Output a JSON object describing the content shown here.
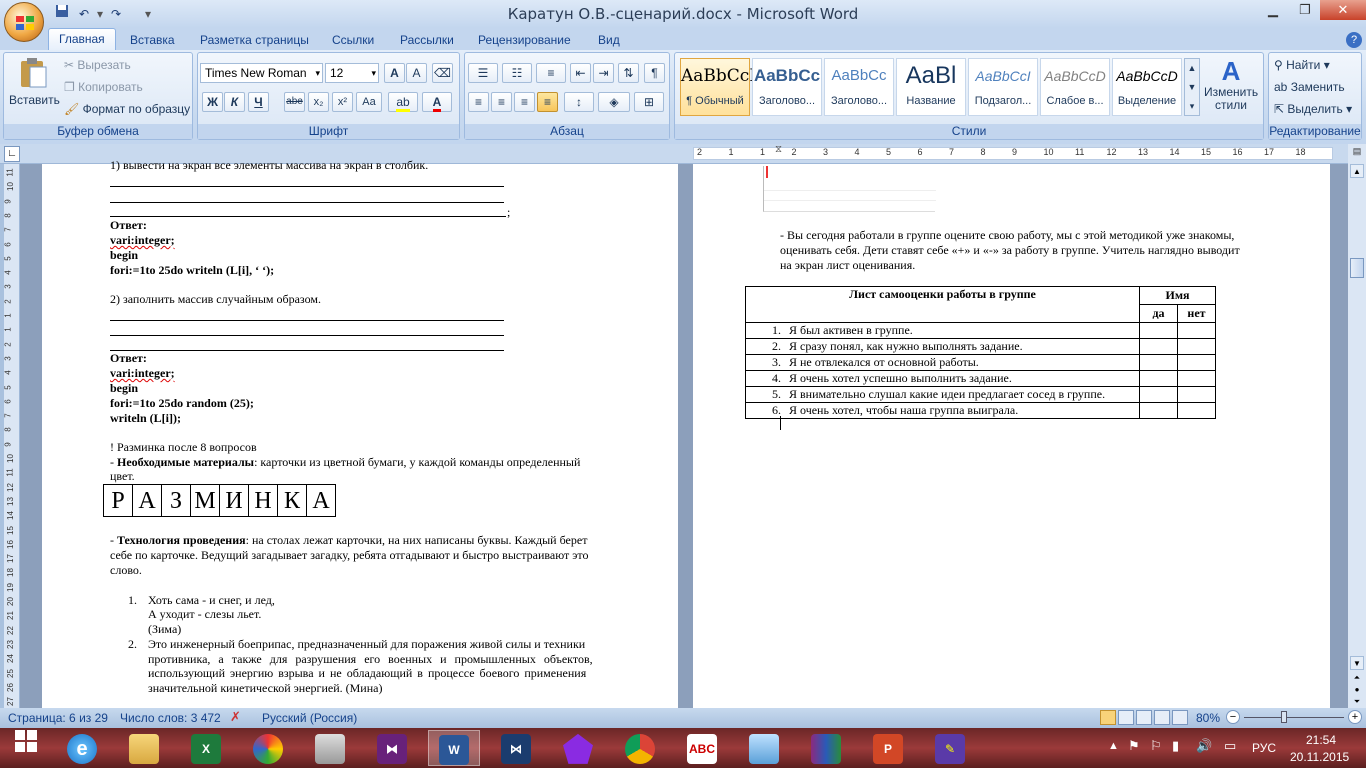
{
  "window": {
    "title": "Каратун О.В.-сценарий.docx - Microsoft Word"
  },
  "tabs": [
    "Главная",
    "Вставка",
    "Разметка страницы",
    "Ссылки",
    "Рассылки",
    "Рецензирование",
    "Вид"
  ],
  "clipboard": {
    "paste": "Вставить",
    "cut": "Вырезать",
    "copy": "Копировать",
    "format": "Формат по образцу",
    "label": "Буфер обмена"
  },
  "font": {
    "name": "Times New Roman",
    "size": "12",
    "label": "Шрифт",
    "bold": "Ж",
    "italic": "К",
    "underline": "Ч",
    "strike": "abe",
    "sub": "x₂",
    "sup": "x²",
    "case": "Aa"
  },
  "paragraph": {
    "label": "Абзац"
  },
  "styles": {
    "label": "Стили",
    "change": "Изменить стили",
    "items": [
      {
        "preview": "AaBbCcI",
        "name": "¶ Обычный"
      },
      {
        "preview": "AaBbCc",
        "name": "Заголово..."
      },
      {
        "preview": "AaBbCc",
        "name": "Заголово..."
      },
      {
        "preview": "AaBl",
        "name": "Название"
      },
      {
        "preview": "AaBbCcI",
        "name": "Подзагол..."
      },
      {
        "preview": "AaBbCcD",
        "name": "Слабое в..."
      },
      {
        "preview": "AaBbCcD",
        "name": "Выделение"
      }
    ]
  },
  "editing": {
    "label": "Редактирование",
    "find": "Найти",
    "replace": "Заменить",
    "select": "Выделить"
  },
  "ruler_h": [
    "2",
    "1",
    "1",
    "2",
    "3",
    "4",
    "5",
    "6",
    "7",
    "8",
    "9",
    "10",
    "11",
    "12",
    "13",
    "14",
    "15",
    "16",
    "17",
    "18"
  ],
  "ruler_v": [
    "11",
    "10",
    "9",
    "8",
    "7",
    "6",
    "5",
    "4",
    "3",
    "2",
    "1",
    "1",
    "2",
    "3",
    "4",
    "5",
    "6",
    "7",
    "8",
    "9",
    "10",
    "11",
    "12",
    "13",
    "14",
    "15",
    "16",
    "17",
    "18",
    "19",
    "20",
    "21",
    "22",
    "23",
    "24",
    "25",
    "26",
    "27",
    "28"
  ],
  "left_page": {
    "task1": "1) вывести на экран все элементы массива на экран в столбик.",
    "answer": "Ответ:",
    "var1": "vari:integer;",
    "begin": "begin",
    "for1": "fori:=1to 25do writeln (L[i], ‘  ‘);",
    "task2": "2) заполнить массив случайным образом.",
    "answer2": "Ответ:",
    "var2": "vari:integer;",
    "begin2": "begin",
    "for2": "fori:=1to 25do random (25);",
    "writeln": "writeln (L[i]);",
    "warmup": "! Разминка после 8 вопросов",
    "materials_b": "Необходимые материалы",
    "materials": ": карточки из цветной бумаги, у каждой команды определенный",
    "materials2": "цвет.",
    "letters": [
      "Р",
      "А",
      "З",
      "М",
      "И",
      "Н",
      "К",
      "А"
    ],
    "tech_b": "Технология проведения",
    "tech1": ": на столах лежат карточки, на них написаны буквы. Каждый берет",
    "tech2": "себе по карточке. Ведущий загадывает загадку, ребята отгадывают и быстро выстраивают это",
    "tech3": "слово.",
    "r1n": "1.",
    "r1a": "Хоть сама - и снег, и лед,",
    "r1b": "А уходит - слезы льет.",
    "r1c": "(Зима)",
    "r2n": "2.",
    "r2a": "Это инженерный боеприпас, предназначенный для поражения живой силы и техники",
    "r2b": "противника, а также для разрушения его военных и промышленных объектов,",
    "r2c": "использующий энергию взрыва и не обладающий в процессе боевого применения",
    "r2d": "значительной кинетической энергией. (Мина)"
  },
  "right_page": {
    "p1": "- Вы сегодня работали в группе оцените свою работу, мы с этой методикой уже знакомы,",
    "p2": "оценивать себя. Дети ставят себе «+» и «-» за работу в группе. Учитель наглядно выводит",
    "p3": "на экран лист оценивания.",
    "table_title": "Лист самооценки работы в группе",
    "name_col": "Имя",
    "yes": "да",
    "no": "нет",
    "rows": [
      {
        "n": "1.",
        "t": "Я был активен в группе."
      },
      {
        "n": "2.",
        "t": "Я сразу понял, как нужно выполнять задание."
      },
      {
        "n": "3.",
        "t": "Я не отвлекался от основной работы."
      },
      {
        "n": "4.",
        "t": "Я очень хотел успешно выполнить задание."
      },
      {
        "n": "5.",
        "t": "Я внимательно слушал какие идеи предлагает сосед в группе."
      },
      {
        "n": "6.",
        "t": "Я очень хотел, чтобы наша группа выиграла."
      }
    ]
  },
  "status": {
    "page": "Страница: 6 из 29",
    "words": "Число слов: 3 472",
    "lang": "Русский (Россия)",
    "zoom": "80%"
  },
  "tray": {
    "lang": "РУС",
    "time": "21:54",
    "date": "20.11.2015"
  }
}
